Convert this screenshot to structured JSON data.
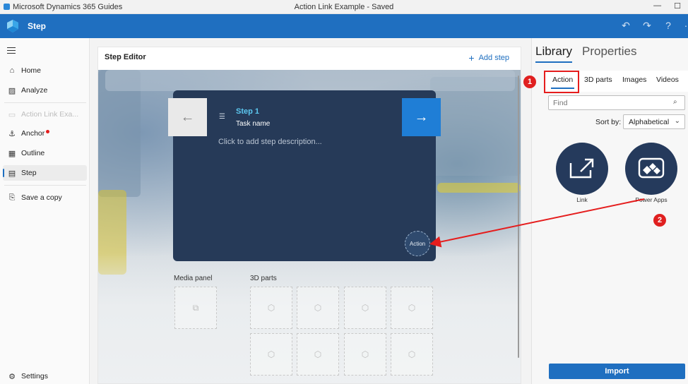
{
  "window": {
    "app_title": "Microsoft Dynamics 365 Guides",
    "doc_title": "Action Link Example - Saved",
    "minimize_glyph": "—",
    "maximize_glyph": "☐"
  },
  "header": {
    "title": "Step",
    "undo_glyph": "↶",
    "redo_glyph": "↷",
    "help_glyph": "?"
  },
  "nav": {
    "items": [
      {
        "label": "Home",
        "icon": "home-icon"
      },
      {
        "label": "Analyze",
        "icon": "analyze-icon"
      },
      {
        "label": "Action Link Exa...",
        "icon": "guide-icon"
      },
      {
        "label": "Anchor",
        "icon": "anchor-icon"
      },
      {
        "label": "Outline",
        "icon": "outline-icon"
      },
      {
        "label": "Step",
        "icon": "step-icon"
      },
      {
        "label": "Save a copy",
        "icon": "save-copy-icon"
      },
      {
        "label": "Settings",
        "icon": "settings-icon"
      }
    ]
  },
  "editor": {
    "title": "Step Editor",
    "add_step": "Add step",
    "card": {
      "step_title": "Step 1",
      "task_name": "Task name",
      "description_placeholder": "Click to add step description...",
      "action_label": "Action"
    },
    "media_panel_label": "Media panel",
    "parts_label": "3D parts"
  },
  "right_panel": {
    "tabs": [
      "Library",
      "Properties"
    ],
    "active_tab": "Library",
    "library_tabs": [
      "Action",
      "3D parts",
      "Images",
      "Videos"
    ],
    "active_library_tab": "Action",
    "find_placeholder": "Find",
    "sort_label": "Sort by:",
    "sort_value": "Alphabetical",
    "items": [
      {
        "name": "Link",
        "icon": "link-icon"
      },
      {
        "name": "Power Apps",
        "icon": "power-apps-icon"
      }
    ],
    "import_label": "Import"
  },
  "callouts": [
    "1",
    "2"
  ],
  "colors": {
    "brand_blue": "#1f6fc0",
    "card_navy": "#263a58",
    "callout_red": "#e02020"
  }
}
